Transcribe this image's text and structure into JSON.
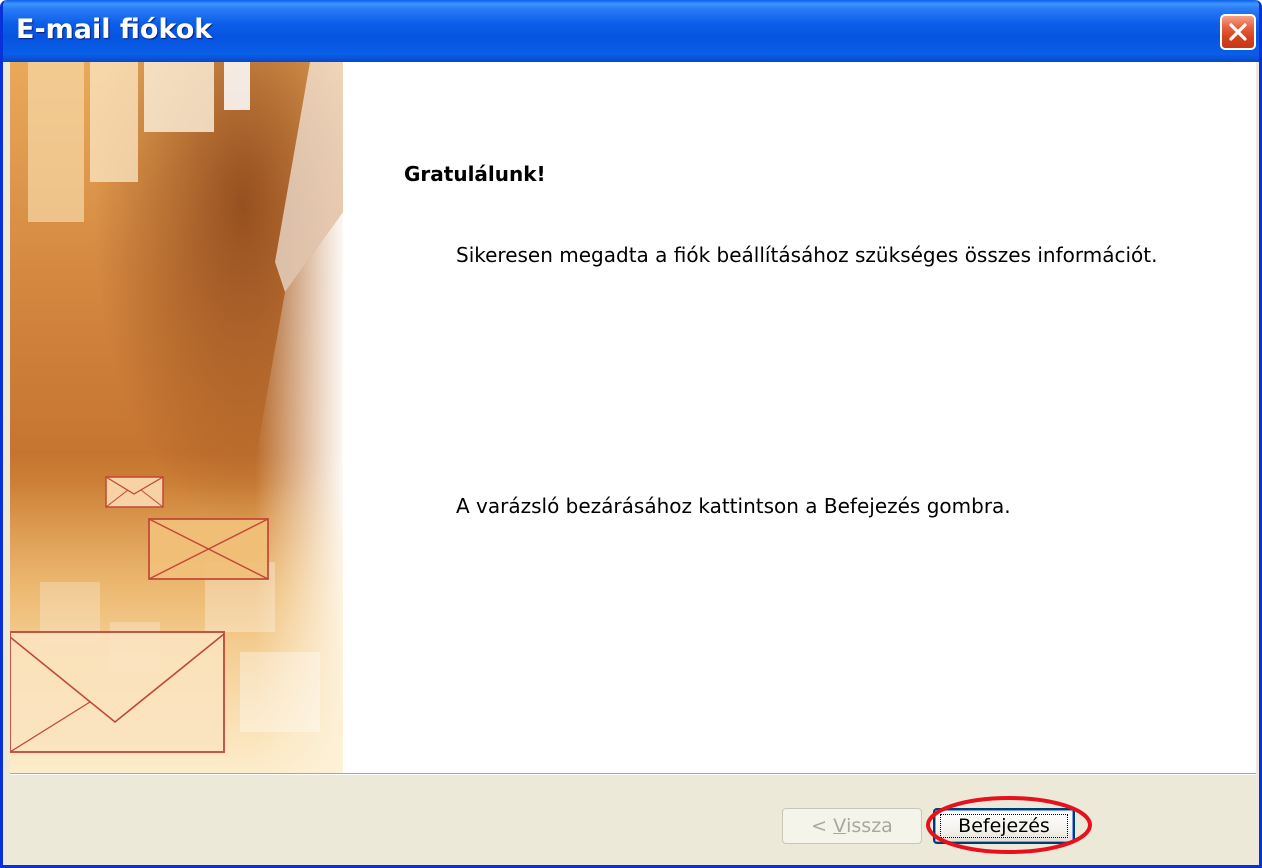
{
  "window": {
    "title": "E-mail fiókok",
    "close_icon": "close-x-icon"
  },
  "content": {
    "heading": "Gratulálunk!",
    "message": "Sikeresen megadta a fiók beállításához szükséges összes információt.",
    "instruction": "A varázsló bezárásához kattintson a Befejezés gombra."
  },
  "buttons": {
    "back_prefix": "< ",
    "back_mnemonic": "V",
    "back_rest": "issza",
    "back_enabled": false,
    "finish_label": "Befejezés",
    "finish_focused": true
  },
  "colors": {
    "titlebar": "#0654e0",
    "close": "#d2401c",
    "highlight_ring": "#e8101c",
    "panel_orange": "#c8742a"
  }
}
